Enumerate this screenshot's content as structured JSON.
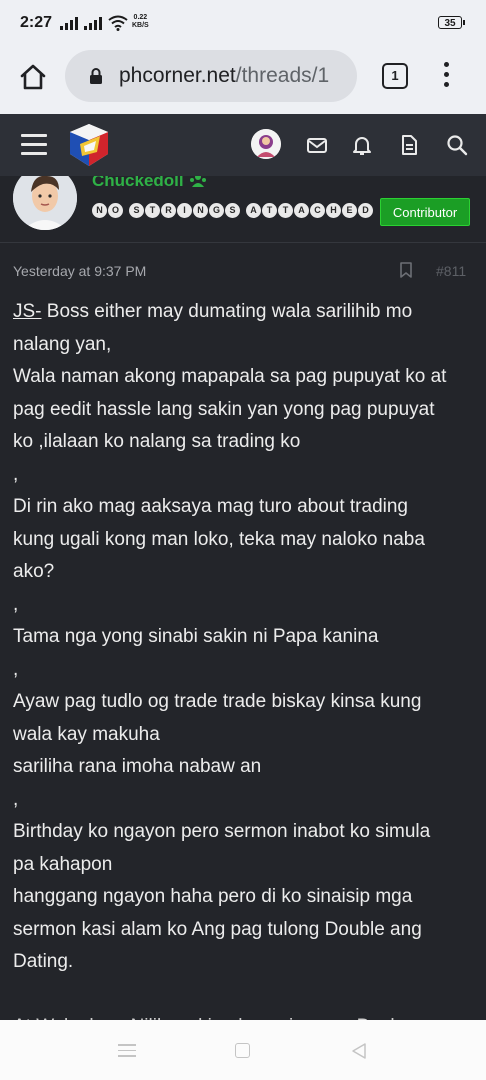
{
  "status_bar": {
    "time": "2:27",
    "net_speed_value": "0.22",
    "net_speed_unit": "KB/S",
    "battery": "35"
  },
  "browser": {
    "url_domain": "phcorner.net",
    "url_path": "/threads/1",
    "tab_count": "1"
  },
  "site_header": {
    "icons": [
      "menu-icon",
      "site-logo",
      "user-avatar",
      "mail-icon",
      "bell-icon",
      "document-icon",
      "search-icon"
    ]
  },
  "post": {
    "username": "Chuckedoll",
    "user_title_letters": [
      "N",
      "O",
      "",
      "S",
      "T",
      "R",
      "I",
      "N",
      "G",
      "S",
      "",
      "A",
      "T",
      "T",
      "A",
      "C",
      "H",
      "E",
      "D"
    ],
    "badge": "Contributor",
    "timestamp": "Yesterday at 9:37 PM",
    "post_number": "#811",
    "lines": [
      {
        "prefix": "JS-",
        "text": " Boss either may dumating wala sarilihib mo"
      },
      {
        "text": "nalang yan,"
      },
      {
        "text": "Wala naman akong mapapala sa pag pupuyat ko at"
      },
      {
        "text": "pag eedit hassle lang sakin yan yong pag pupuyat"
      },
      {
        "text": "ko ,ilalaan ko nalang sa trading ko"
      },
      {
        "text": ","
      },
      {
        "text": "Di rin ako mag aaksaya mag turo about trading"
      },
      {
        "text": "kung ugali kong man loko, teka may naloko naba"
      },
      {
        "text": "ako?"
      },
      {
        "text": ","
      },
      {
        "text": "Tama nga yong sinabi sakin ni Papa kanina"
      },
      {
        "text": ","
      },
      {
        "text": "Ayaw pag tudlo og trade trade biskay kinsa kung"
      },
      {
        "text": "wala kay makuha"
      },
      {
        "text": "sariliha rana imoha nabaw an"
      },
      {
        "text": ","
      },
      {
        "text": "Birthday ko ngayon pero sermon inabot ko simula"
      },
      {
        "text": "pa kahapon"
      },
      {
        "text": "hanggang ngayon haha pero di ko sinaisip mga"
      },
      {
        "text": "sermon kasi alam ko Ang pag tulong Double ang"
      },
      {
        "text": "Dating."
      },
      {
        "text": ""
      },
      {
        "text": "At Waka lang Nililamaking lang sinasara Bank"
      }
    ]
  },
  "colors": {
    "accent_green": "#2fb146",
    "badge_green": "#1b9e25",
    "page_bg": "#23252a"
  }
}
